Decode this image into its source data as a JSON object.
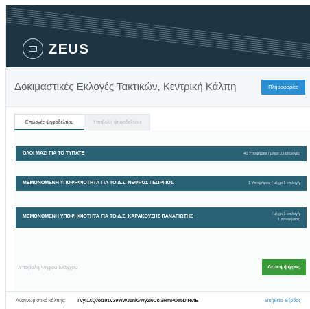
{
  "header": {
    "logo_text": "ZEUS",
    "logo_icon": "ballot-box-icon",
    "background": "#1d3442"
  },
  "election": {
    "title": "Δοκιμαστικές Εκλογές Τακτικών, Κεντρική Κάλπη",
    "info_button": "Πληροφορίες"
  },
  "tabs": [
    {
      "label": "Επιλογές ψηφοδελτίου",
      "active": true
    },
    {
      "label": "Υποβολή ψηφοδελτίου",
      "active": false
    }
  ],
  "questions": [
    {
      "title": "ΟΛΟΙ ΜΑΖΙ ΓΙΑ ΤΟ ΤΥΠΑΤΕ",
      "info": "40 Υποψήφιοι / μέχρι 23 επιλογές"
    },
    {
      "title": "ΜΕΜΟΝΟΜΕΝΗ ΥΠΟΨΗΦΙΟΤΗΤΑ ΓΙΑ ΤΟ Δ.Σ. ΝΕΦΡΟΣ ΓΕΩΡΓΙΟΣ",
      "info": "1 Υποψήφιος / μέχρι 1 επιλογή"
    },
    {
      "title": "ΜΕΜΟΝΟΜΕΝΗ ΥΠΟΨΗΦΙΟΤΗΤΑ ΓΙΑ ΤΟ Δ.Σ. ΚΑΡΑΚΟΥΣΗΣ ΠΑΝΑΓΙΩΤΗΣ",
      "info_line1": "/ μέχρι 1 επιλογή",
      "info_line2": "1 Υποψήφιος"
    }
  ],
  "actions": {
    "submit_test_vote": "Υποβολή Ψήφου Ελέγχου",
    "blank_vote": "Λευκή ψήφος"
  },
  "footer": {
    "fingerprint_label": "Αναγνωριστικό κάλπης:",
    "fingerprint_value": "TVyl1XQAx101V39WWJ1nlGWy2l0Ccl3HmPOe5DlHvtE",
    "help": "Βοήθεια",
    "logout": "Έξοδος"
  },
  "colors": {
    "question_bar": "#2a6175",
    "info_button": "#2b8fd1",
    "blank_button": "#3a9b3a",
    "link": "#3b8ed0"
  }
}
